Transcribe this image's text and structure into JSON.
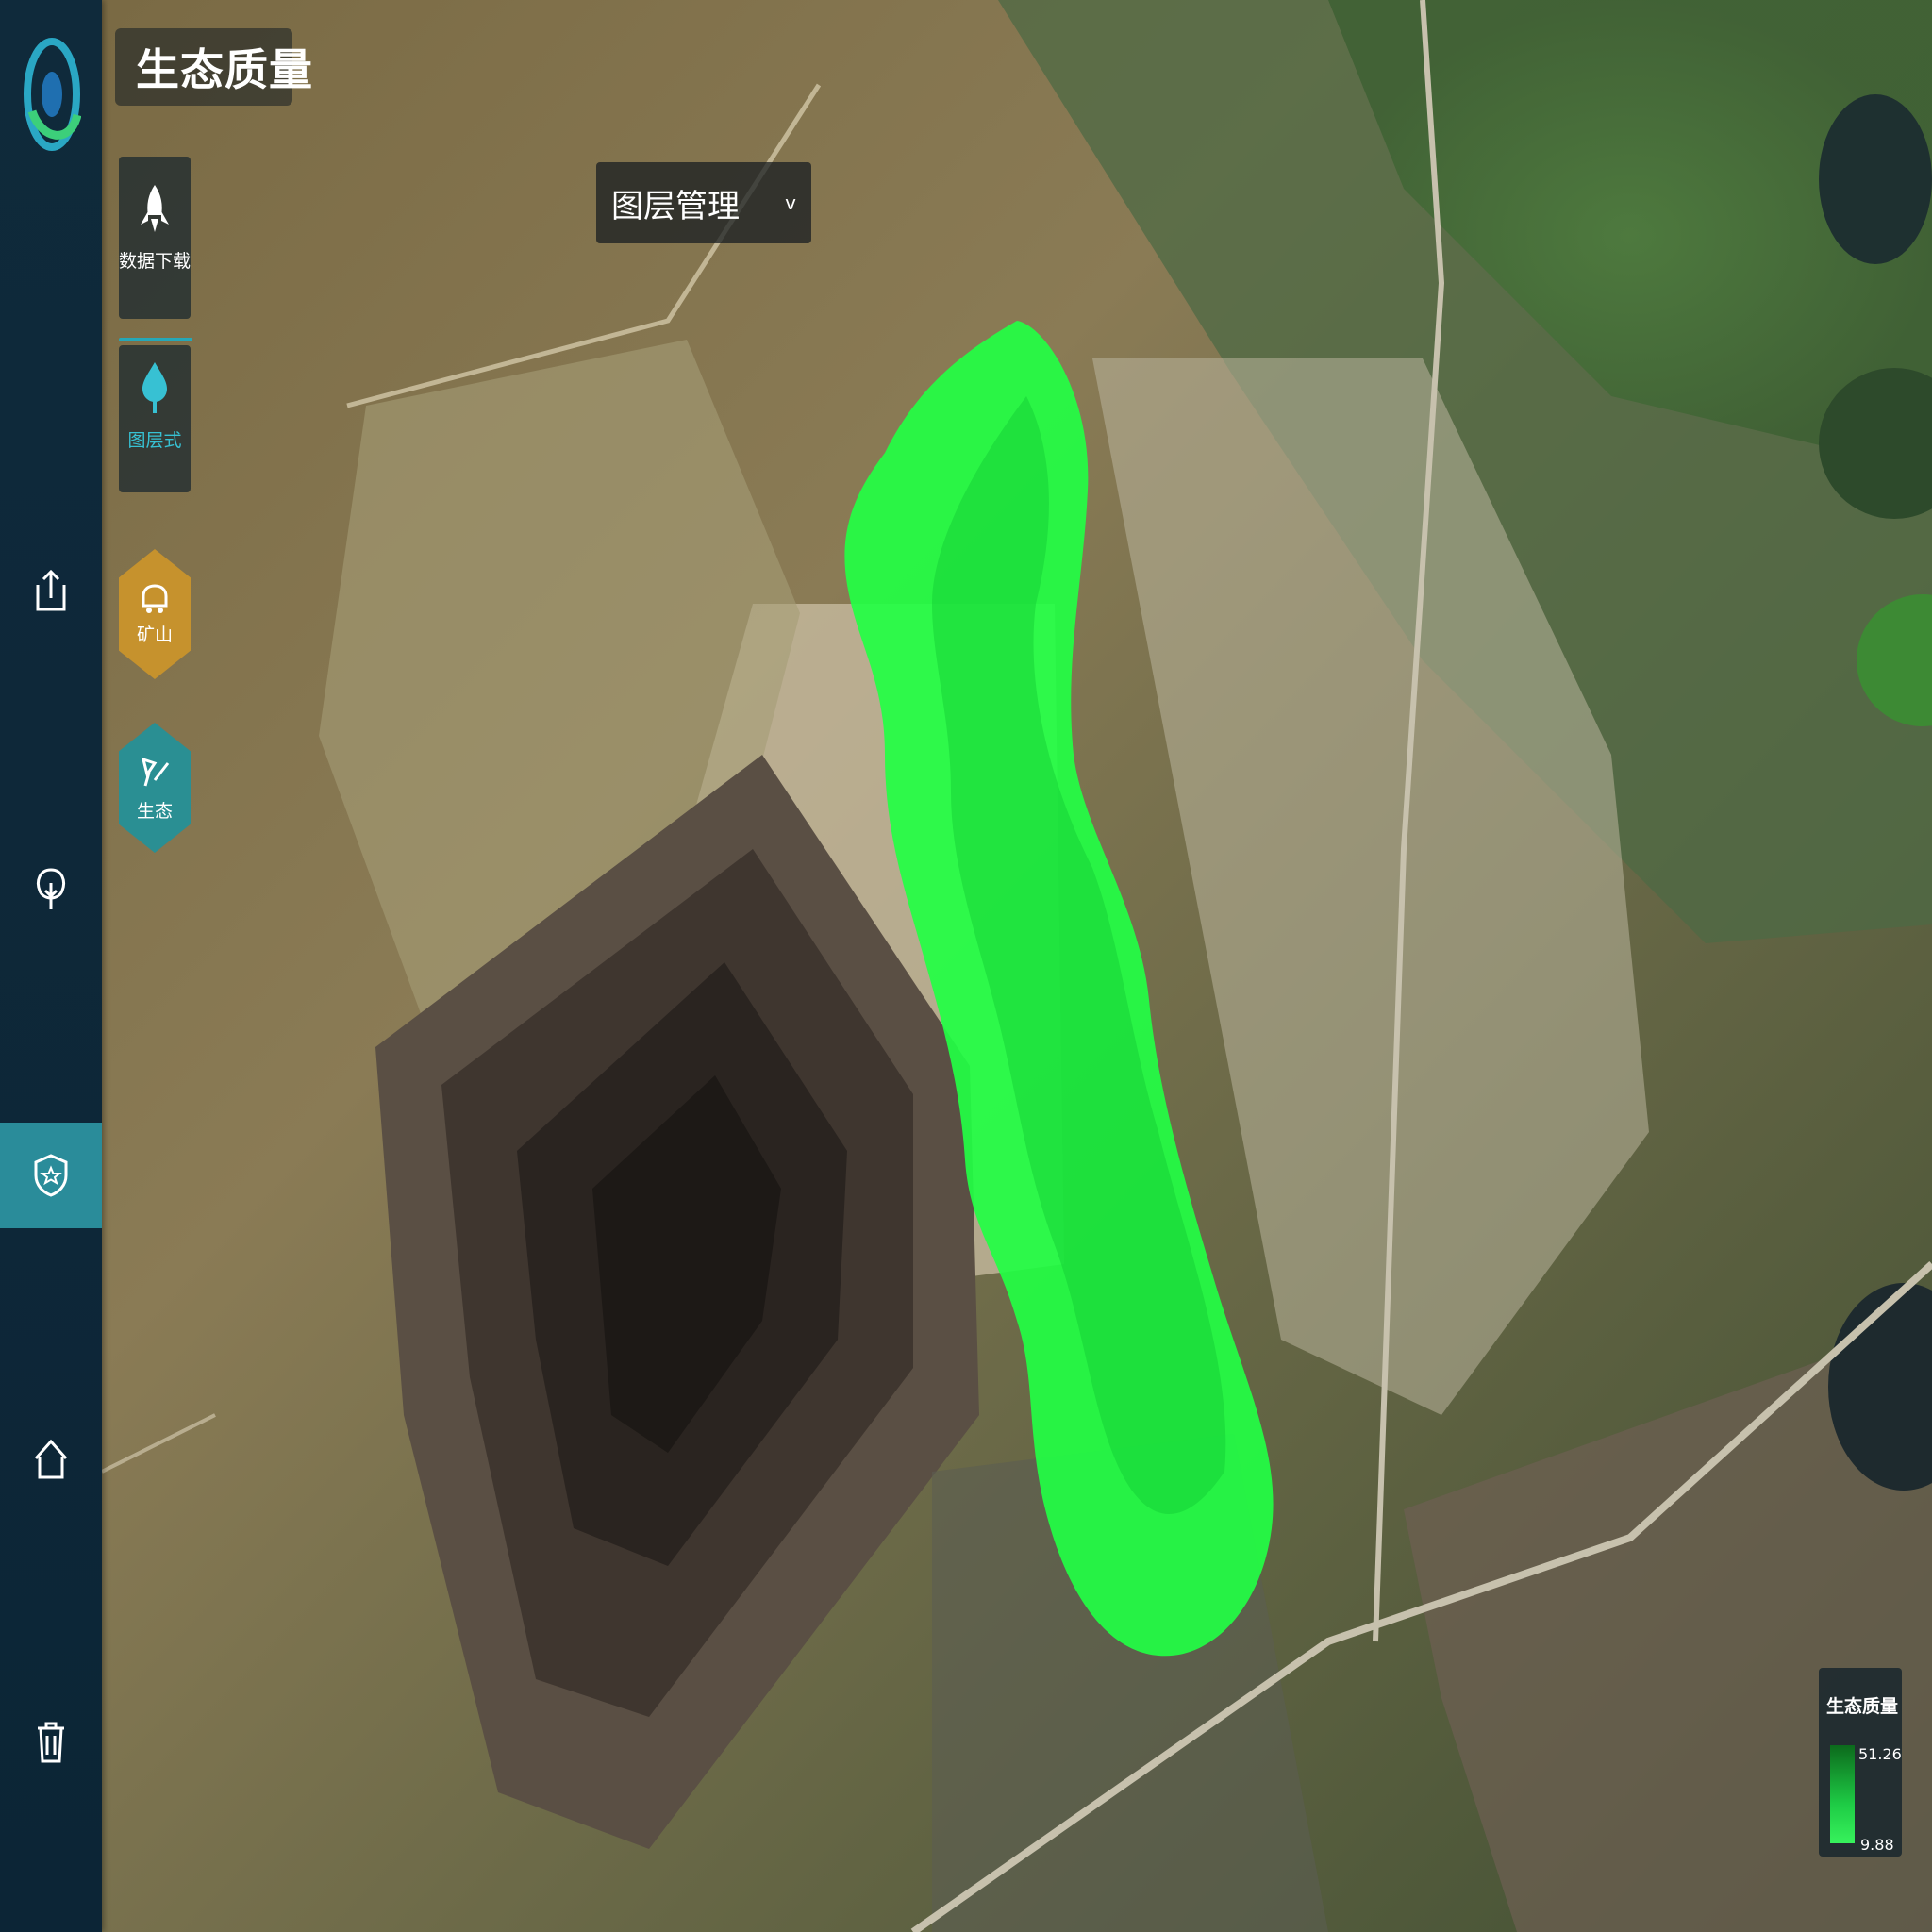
{
  "app": {
    "title": "生态质量",
    "logo_icon": "swirl-logo-icon"
  },
  "rail": {
    "items": [
      {
        "name": "export",
        "icon": "export-icon"
      },
      {
        "name": "tree",
        "icon": "tree-icon"
      },
      {
        "name": "shield",
        "icon": "shield-star-icon",
        "active": true
      },
      {
        "name": "home",
        "icon": "home-icon"
      },
      {
        "name": "delete",
        "icon": "trash-icon"
      }
    ]
  },
  "tools": {
    "card1_label": "数据下载",
    "card2_label": "图层式",
    "hex1_label": "矿山",
    "hex2_label": "生态"
  },
  "layer_dropdown": {
    "label": "图层管理"
  },
  "legend": {
    "title": "生态质量",
    "max": "51.26",
    "min": "9.88",
    "color_low": "#37f25c",
    "color_high": "#0c6a1c"
  },
  "colors": {
    "accent": "#2a8c9a",
    "overlay_green": "#22ff44",
    "hex_gold": "#c6922d",
    "hex_teal": "#2a8f93"
  }
}
